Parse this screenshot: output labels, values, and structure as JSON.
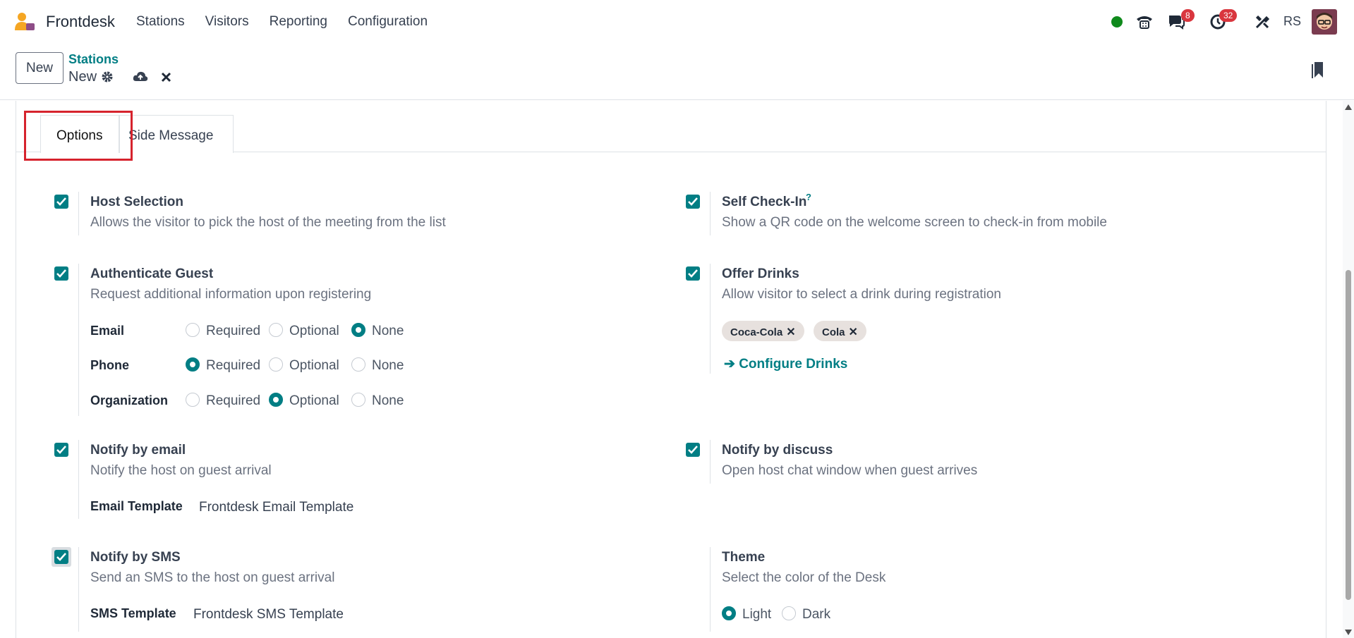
{
  "app": {
    "name": "Frontdesk",
    "menu": [
      "Stations",
      "Visitors",
      "Reporting",
      "Configuration"
    ]
  },
  "systray": {
    "messages_badge": "8",
    "activities_badge": "32",
    "user_initials": "RS"
  },
  "control_panel": {
    "new_label": "New",
    "breadcrumb_parent": "Stations",
    "breadcrumb_current": "New"
  },
  "tabs": [
    {
      "label": "Options",
      "active": true
    },
    {
      "label": "Side Message",
      "active": false
    }
  ],
  "settings": {
    "host_selection": {
      "title": "Host Selection",
      "desc": "Allows the visitor to pick the host of the meeting from the list",
      "checked": true
    },
    "self_check_in": {
      "title": "Self Check-In",
      "help": "?",
      "desc": "Show a QR code on the welcome screen to check-in from mobile",
      "checked": true
    },
    "authenticate_guest": {
      "title": "Authenticate Guest",
      "desc": "Request additional information upon registering",
      "checked": true,
      "options": [
        "Required",
        "Optional",
        "None"
      ],
      "fields": [
        {
          "label": "Email",
          "selected": "None"
        },
        {
          "label": "Phone",
          "selected": "Required"
        },
        {
          "label": "Organization",
          "selected": "Optional"
        }
      ]
    },
    "offer_drinks": {
      "title": "Offer Drinks",
      "desc": "Allow visitor to select a drink during registration",
      "checked": true,
      "drinks": [
        "Coca-Cola",
        "Cola"
      ],
      "configure_link": "Configure Drinks"
    },
    "notify_email": {
      "title": "Notify by email",
      "desc": "Notify the host on guest arrival",
      "checked": true,
      "template_label": "Email Template",
      "template_value": "Frontdesk Email Template"
    },
    "notify_discuss": {
      "title": "Notify by discuss",
      "desc": "Open host chat window when guest arrives",
      "checked": true
    },
    "notify_sms": {
      "title": "Notify by SMS",
      "desc": "Send an SMS to the host on guest arrival",
      "checked": true,
      "template_label": "SMS Template",
      "template_value": "Frontdesk SMS Template"
    },
    "theme": {
      "title": "Theme",
      "desc": "Select the color of the Desk",
      "options": [
        "Light",
        "Dark"
      ],
      "selected": "Light"
    }
  },
  "colors": {
    "accent": "#017e84",
    "highlight_box": "#d6232d",
    "badge": "#d9363e",
    "online_dot": "#0f8a1c"
  }
}
